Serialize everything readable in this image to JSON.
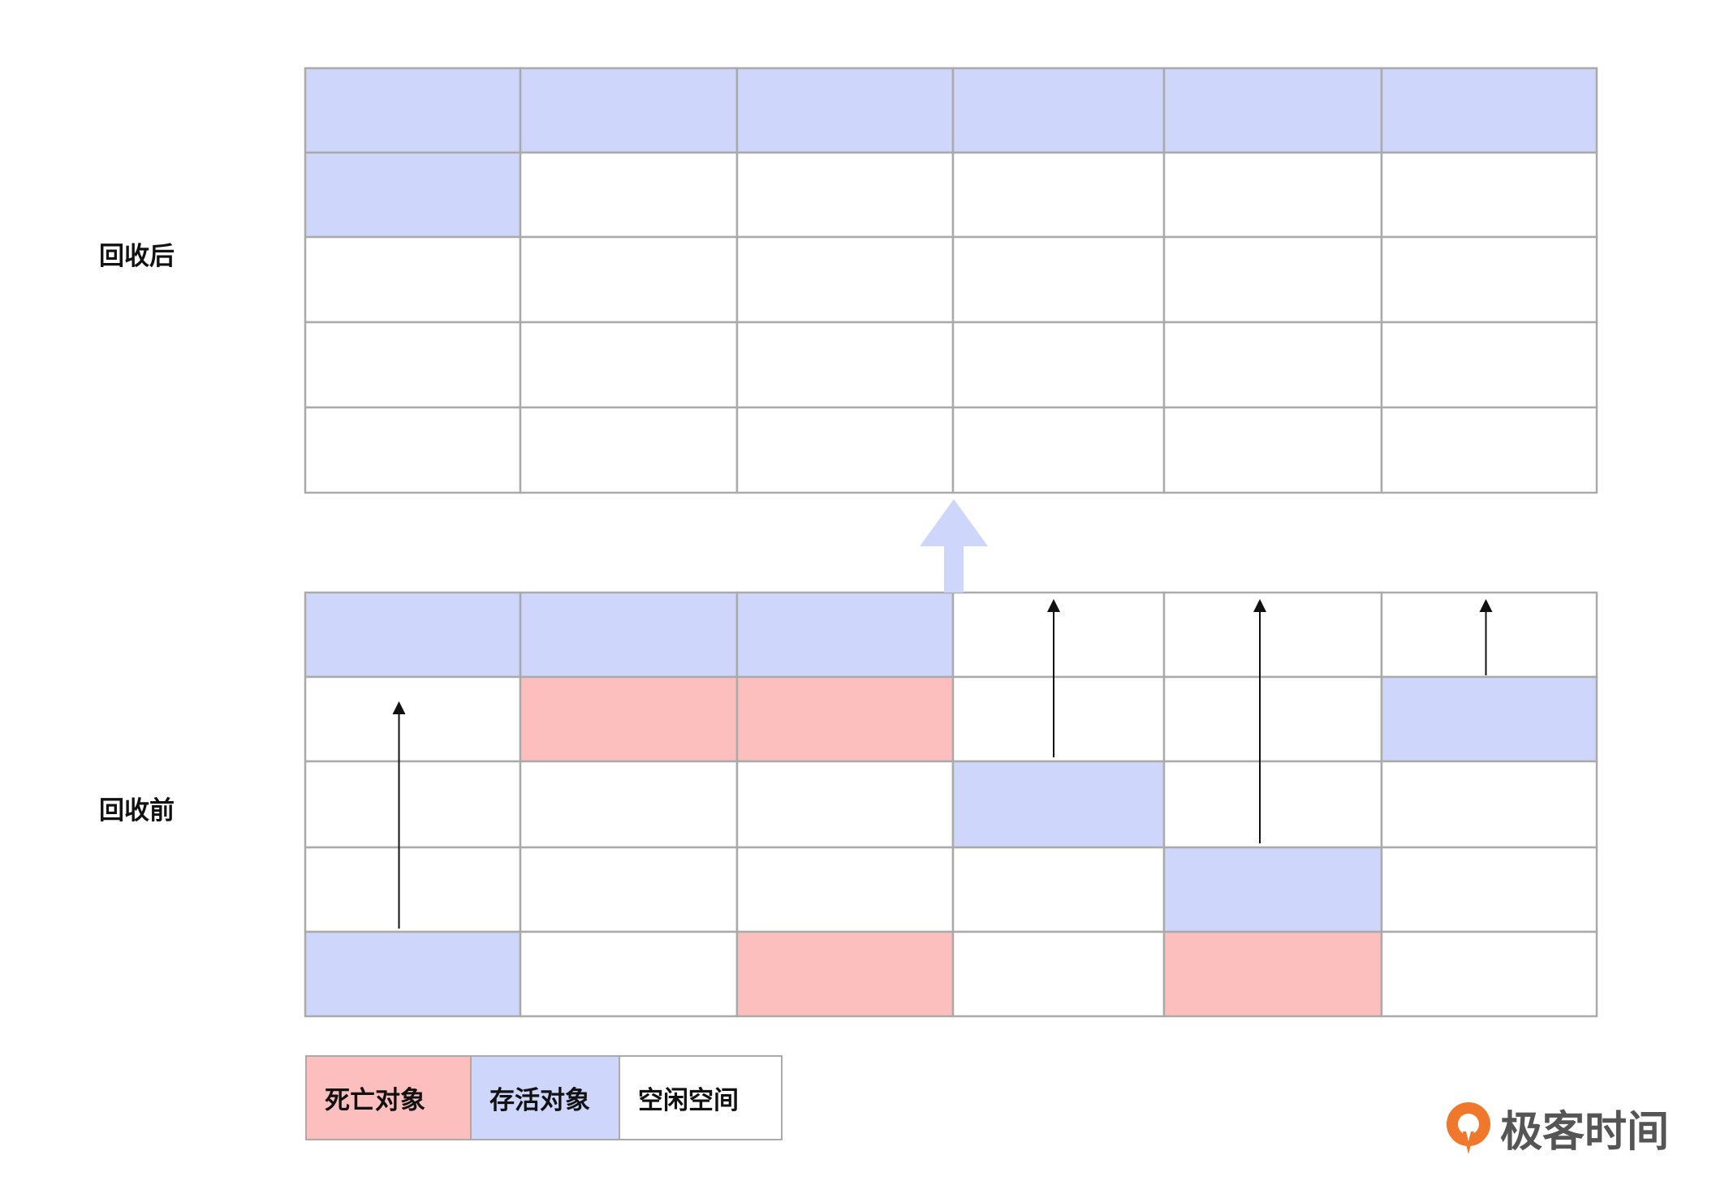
{
  "labels": {
    "after": "回收后",
    "before": "回收前"
  },
  "colors": {
    "live": "#cfd6fc",
    "dead": "#fdbfbe",
    "free": "#ffffff",
    "border": "#aaaaaa",
    "arrow_big": "#cfd6fc",
    "arrow_small": "#111111"
  },
  "grid_after": [
    [
      "live",
      "live",
      "live",
      "live",
      "live",
      "live"
    ],
    [
      "live",
      "free",
      "free",
      "free",
      "free",
      "free"
    ],
    [
      "free",
      "free",
      "free",
      "free",
      "free",
      "free"
    ],
    [
      "free",
      "free",
      "free",
      "free",
      "free",
      "free"
    ],
    [
      "free",
      "free",
      "free",
      "free",
      "free",
      "free"
    ]
  ],
  "grid_before": [
    [
      "live",
      "live",
      "live",
      "free",
      "free",
      "free"
    ],
    [
      "free",
      "dead",
      "dead",
      "free",
      "free",
      "live"
    ],
    [
      "free",
      "free",
      "free",
      "live",
      "free",
      "free"
    ],
    [
      "free",
      "free",
      "free",
      "free",
      "live",
      "free"
    ],
    [
      "live",
      "free",
      "dead",
      "free",
      "dead",
      "free"
    ]
  ],
  "moves": [
    {
      "col": 0,
      "from_row": 4,
      "to_row": 0
    },
    {
      "col": 3,
      "from_row": 2,
      "to_row": 0
    },
    {
      "col": 4,
      "from_row": 3,
      "to_row": 0
    },
    {
      "col": 5,
      "from_row": 1,
      "to_row": 0
    }
  ],
  "legend": [
    {
      "label": "死亡对象",
      "state": "dead"
    },
    {
      "label": "存活对象",
      "state": "live"
    },
    {
      "label": "空闲空间",
      "state": "free"
    }
  ],
  "logo": {
    "text": "极客时间"
  }
}
